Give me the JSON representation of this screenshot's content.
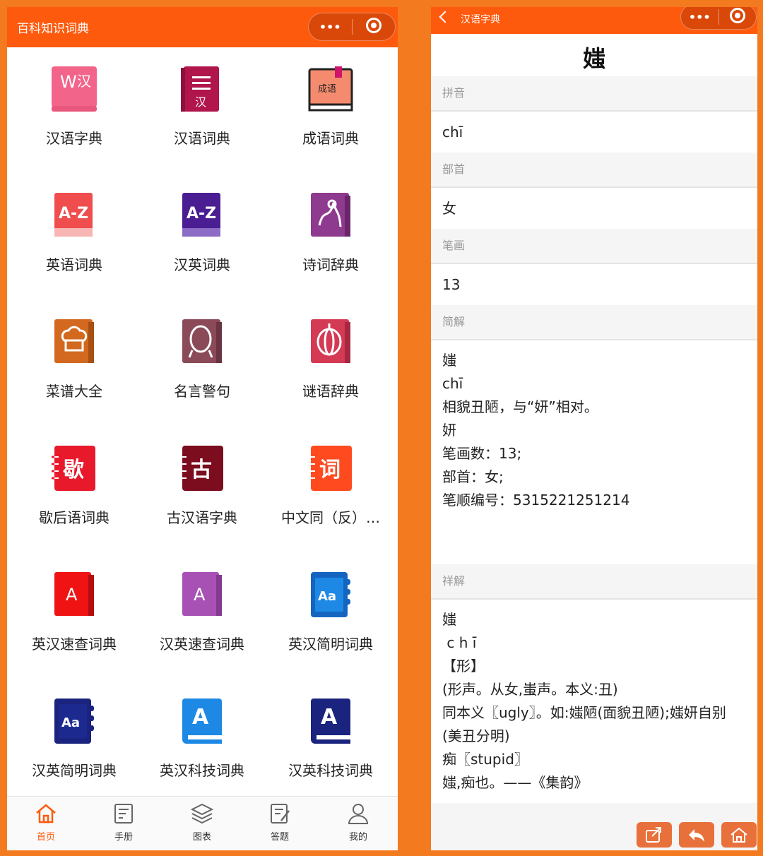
{
  "left": {
    "title": "百科知识词典",
    "menu_dots": "•••",
    "items": [
      {
        "label": "汉语字典",
        "icon": "hanyu-zidian-icon"
      },
      {
        "label": "汉语词典",
        "icon": "hanyu-cidian-icon",
        "glyph": "汉"
      },
      {
        "label": "成语词典",
        "icon": "chengyu-cidian-icon",
        "glyph": "成语"
      },
      {
        "label": "英语词典",
        "icon": "az-red-icon",
        "glyph": "A-Z"
      },
      {
        "label": "汉英词典",
        "icon": "az-purple-icon",
        "glyph": "A-Z"
      },
      {
        "label": "诗词辞典",
        "icon": "poetry-icon"
      },
      {
        "label": "菜谱大全",
        "icon": "chef-hat-icon"
      },
      {
        "label": "名言警句",
        "icon": "face-icon"
      },
      {
        "label": "谜语辞典",
        "icon": "lantern-icon"
      },
      {
        "label": "歇后语词典",
        "icon": "xie-notebook-icon",
        "glyph": "歇"
      },
      {
        "label": "古汉语字典",
        "icon": "gu-notebook-icon",
        "glyph": "古"
      },
      {
        "label": "中文同（反）…",
        "icon": "ci-notebook-icon",
        "glyph": "词"
      },
      {
        "label": "英汉速查词典",
        "icon": "a-red-book-icon",
        "glyph": "A"
      },
      {
        "label": "汉英速查词典",
        "icon": "a-purple-book-icon",
        "glyph": "A"
      },
      {
        "label": "英汉简明词典",
        "icon": "aa-blue-notebook-icon",
        "glyph": "Aa"
      },
      {
        "label": "汉英简明词典",
        "icon": "aa-navy-notebook-icon",
        "glyph": "Aa"
      },
      {
        "label": "英汉科技词典",
        "icon": "a-lightblue-book-icon",
        "glyph": "A"
      },
      {
        "label": "汉英科技词典",
        "icon": "a-navy-book-icon",
        "glyph": "A"
      }
    ],
    "tabs": [
      {
        "label": "首页",
        "icon": "home-icon",
        "active": true
      },
      {
        "label": "手册",
        "icon": "manual-icon",
        "active": false
      },
      {
        "label": "图表",
        "icon": "layers-icon",
        "active": false
      },
      {
        "label": "答题",
        "icon": "quiz-icon",
        "active": false
      },
      {
        "label": "我的",
        "icon": "profile-icon",
        "active": false
      }
    ]
  },
  "right": {
    "title": "汉语字典",
    "menu_dots": "•••",
    "char": "媸",
    "pinyin_title": "拼音",
    "pinyin": "chī",
    "radical_title": "部首",
    "radical": "女",
    "strokes_title": "笔画",
    "strokes": "13",
    "brief_title": "简解",
    "brief_lines": [
      "媸",
      "chī",
      "相貌丑陋，与“妍”相对。",
      "妍",
      "",
      "笔画数：13;",
      "部首：女;",
      "笔顺编号：5315221251214"
    ],
    "detail_title": "祥解",
    "detail_lines": [
      "媸",
      " c h ī",
      "【形】",
      "(形声。从女,蚩声。本义:丑)",
      "同本义〖ugly〗。如:媸陋(面貌丑陋);媸妍自别",
      "(美丑分明)",
      "痴〖stupid〗",
      "媸,痴也。——《集韵》"
    ],
    "actions": [
      {
        "name": "share-button",
        "icon": "share-icon"
      },
      {
        "name": "back-button",
        "icon": "reply-icon"
      },
      {
        "name": "home-button",
        "icon": "home-icon"
      }
    ]
  },
  "colors": {
    "accent": "#fe5a0e",
    "frame": "#f47a1f"
  }
}
